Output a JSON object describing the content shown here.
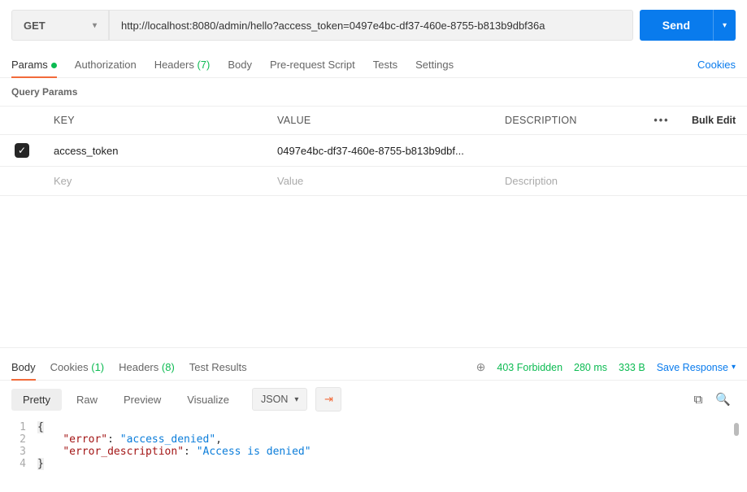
{
  "request": {
    "method": "GET",
    "url": "http://localhost:8080/admin/hello?access_token=0497e4bc-df37-460e-8755-b813b9dbf36a",
    "send_label": "Send"
  },
  "req_tabs": {
    "params": "Params",
    "authorization": "Authorization",
    "headers": "Headers",
    "headers_count": "(7)",
    "body": "Body",
    "prereq": "Pre-request Script",
    "tests": "Tests",
    "settings": "Settings",
    "cookies": "Cookies"
  },
  "query_params": {
    "section_label": "Query Params",
    "header": {
      "key": "KEY",
      "value": "VALUE",
      "description": "DESCRIPTION",
      "bulk": "Bulk Edit",
      "more": "•••"
    },
    "rows": [
      {
        "checked": true,
        "key": "access_token",
        "value": "0497e4bc-df37-460e-8755-b813b9dbf..."
      }
    ],
    "placeholder": {
      "key": "Key",
      "value": "Value",
      "description": "Description"
    }
  },
  "response": {
    "tabs": {
      "body": "Body",
      "cookies": "Cookies",
      "cookies_count": "(1)",
      "headers": "Headers",
      "headers_count": "(8)",
      "test_results": "Test Results"
    },
    "status": "403 Forbidden",
    "time": "280 ms",
    "size": "333 B",
    "save": "Save Response",
    "view_tabs": {
      "pretty": "Pretty",
      "raw": "Raw",
      "preview": "Preview",
      "visualize": "Visualize"
    },
    "format": "JSON",
    "body_lines": {
      "l1_open": "{",
      "l2_key": "\"error\"",
      "l2_val": "\"access_denied\"",
      "l3_key": "\"error_description\"",
      "l3_val": "\"Access is denied\"",
      "l4_close": "}"
    }
  }
}
